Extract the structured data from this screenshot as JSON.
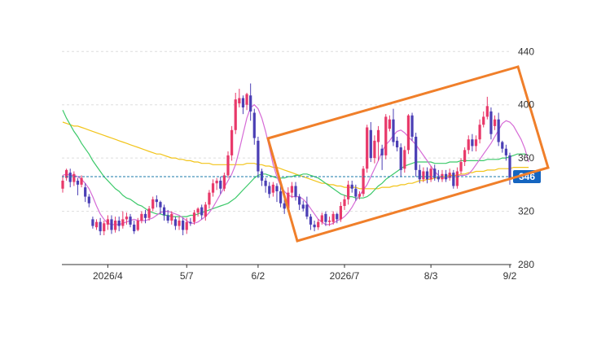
{
  "chart_data": {
    "type": "candlestick",
    "x_tick_labels": [
      "2026/4",
      "5/7",
      "6/2",
      "2026/7",
      "8/3",
      "9/2"
    ],
    "y_tick_labels": [
      "280",
      "320",
      "360",
      "400",
      "440"
    ],
    "y_ticks": [
      280,
      320,
      360,
      400,
      440
    ],
    "ylim": [
      280,
      442
    ],
    "grid": true,
    "last_price": 346,
    "last_price_label": "346",
    "colors": {
      "up": "#e8396a",
      "down": "#4b3fb5",
      "ma_short": "#d66bd6",
      "ma_mid": "#3cc96a",
      "ma_long": "#f2c41a",
      "channel": "#f07f2a",
      "last_price_line": "#1a7aa8",
      "last_price_badge": "#1565c0",
      "grid": "#dddddd",
      "axis": "#333333"
    },
    "candles": [
      [
        337,
        343,
        334,
        347
      ],
      [
        345,
        351,
        343,
        352
      ],
      [
        349,
        342,
        338,
        352
      ],
      [
        342,
        348,
        339,
        350
      ],
      [
        343,
        340,
        332,
        345
      ],
      [
        340,
        345,
        338,
        347
      ],
      [
        338,
        331,
        327,
        341
      ],
      [
        331,
        326,
        323,
        333
      ],
      [
        314,
        309,
        307,
        316
      ],
      [
        308,
        312,
        306,
        314
      ],
      [
        312,
        305,
        302,
        315
      ],
      [
        305,
        311,
        302,
        313
      ],
      [
        310,
        314,
        306,
        317
      ],
      [
        314,
        306,
        303,
        317
      ],
      [
        306,
        313,
        304,
        316
      ],
      [
        313,
        309,
        305,
        316
      ],
      [
        309,
        314,
        307,
        320
      ],
      [
        314,
        316,
        310,
        319
      ],
      [
        316,
        310,
        308,
        318
      ],
      [
        310,
        305,
        303,
        313
      ],
      [
        306,
        313,
        305,
        315
      ],
      [
        313,
        318,
        311,
        320
      ],
      [
        318,
        315,
        311,
        321
      ],
      [
        315,
        322,
        313,
        324
      ],
      [
        322,
        329,
        320,
        331
      ],
      [
        329,
        327,
        323,
        332
      ],
      [
        327,
        323,
        318,
        328
      ],
      [
        323,
        317,
        313,
        325
      ],
      [
        317,
        313,
        311,
        321
      ],
      [
        313,
        318,
        310,
        320
      ],
      [
        314,
        309,
        306,
        316
      ],
      [
        309,
        313,
        306,
        316
      ],
      [
        313,
        306,
        302,
        315
      ],
      [
        306,
        312,
        303,
        315
      ],
      [
        312,
        311,
        309,
        315
      ],
      [
        312,
        319,
        310,
        321
      ],
      [
        319,
        322,
        316,
        323
      ],
      [
        323,
        317,
        314,
        325
      ],
      [
        316,
        325,
        313,
        327
      ],
      [
        325,
        334,
        322,
        336
      ],
      [
        334,
        341,
        331,
        344
      ],
      [
        341,
        343,
        336,
        345
      ],
      [
        343,
        337,
        333,
        346
      ],
      [
        337,
        347,
        335,
        349
      ],
      [
        347,
        362,
        345,
        365
      ],
      [
        362,
        381,
        358,
        384
      ],
      [
        381,
        404,
        378,
        409
      ],
      [
        401,
        405,
        398,
        412
      ],
      [
        405,
        398,
        393,
        407
      ],
      [
        400,
        408,
        396,
        409
      ],
      [
        407,
        395,
        388,
        416
      ],
      [
        394,
        375,
        370,
        397
      ],
      [
        373,
        350,
        345,
        376
      ],
      [
        350,
        343,
        339,
        352
      ],
      [
        343,
        339,
        334,
        345
      ],
      [
        339,
        333,
        330,
        342
      ],
      [
        334,
        340,
        331,
        342
      ],
      [
        339,
        335,
        327,
        341
      ],
      [
        335,
        326,
        323,
        340
      ],
      [
        326,
        322,
        318,
        329
      ],
      [
        322,
        334,
        320,
        338
      ],
      [
        334,
        339,
        330,
        342
      ],
      [
        339,
        331,
        328,
        342
      ],
      [
        331,
        325,
        321,
        333
      ],
      [
        325,
        322,
        320,
        328
      ],
      [
        325,
        316,
        314,
        331
      ],
      [
        316,
        310,
        306,
        318
      ],
      [
        310,
        308,
        305,
        313
      ],
      [
        308,
        312,
        306,
        314
      ],
      [
        312,
        317,
        310,
        319
      ],
      [
        318,
        312,
        309,
        320
      ],
      [
        312,
        313,
        309,
        316
      ],
      [
        312,
        318,
        310,
        320
      ],
      [
        318,
        314,
        311,
        319
      ],
      [
        314,
        324,
        312,
        327
      ],
      [
        324,
        329,
        321,
        332
      ],
      [
        329,
        340,
        325,
        343
      ],
      [
        340,
        337,
        334,
        343
      ],
      [
        337,
        331,
        328,
        340
      ],
      [
        331,
        333,
        329,
        335
      ],
      [
        333,
        352,
        331,
        354
      ],
      [
        352,
        383,
        349,
        385
      ],
      [
        381,
        360,
        357,
        387
      ],
      [
        360,
        373,
        356,
        377
      ],
      [
        372,
        381,
        358,
        384
      ],
      [
        367,
        362,
        351,
        370
      ],
      [
        362,
        391,
        359,
        393
      ],
      [
        382,
        389,
        380,
        392
      ],
      [
        389,
        372,
        369,
        397
      ],
      [
        373,
        368,
        365,
        376
      ],
      [
        368,
        351,
        346,
        371
      ],
      [
        352,
        366,
        349,
        369
      ],
      [
        366,
        392,
        363,
        393
      ],
      [
        392,
        376,
        373,
        394
      ],
      [
        376,
        351,
        346,
        379
      ],
      [
        351,
        344,
        341,
        355
      ],
      [
        344,
        350,
        342,
        353
      ],
      [
        350,
        344,
        341,
        353
      ],
      [
        344,
        352,
        342,
        354
      ],
      [
        352,
        345,
        343,
        355
      ],
      [
        346,
        344,
        342,
        351
      ],
      [
        344,
        348,
        342,
        351
      ],
      [
        348,
        344,
        342,
        351
      ],
      [
        345,
        349,
        343,
        352
      ],
      [
        349,
        339,
        337,
        351
      ],
      [
        339,
        350,
        337,
        353
      ],
      [
        350,
        357,
        348,
        360
      ],
      [
        357,
        366,
        354,
        368
      ],
      [
        366,
        374,
        363,
        377
      ],
      [
        374,
        369,
        365,
        378
      ],
      [
        369,
        374,
        365,
        377
      ],
      [
        374,
        385,
        371,
        389
      ],
      [
        385,
        391,
        383,
        395
      ],
      [
        391,
        399,
        389,
        406
      ],
      [
        395,
        378,
        374,
        398
      ],
      [
        384,
        389,
        381,
        392
      ],
      [
        389,
        372,
        369,
        394
      ],
      [
        372,
        367,
        364,
        373
      ],
      [
        367,
        362,
        358,
        370
      ],
      [
        362,
        345,
        340,
        364
      ]
    ],
    "ma_short": [
      347,
      348,
      347,
      347,
      346,
      344,
      341,
      337,
      331,
      324,
      318,
      314,
      311,
      310,
      310,
      310,
      311,
      312,
      313,
      314,
      313,
      313,
      313,
      314,
      315,
      317,
      319,
      320,
      320,
      319,
      318,
      317,
      315,
      313,
      311,
      311,
      312,
      314,
      316,
      319,
      323,
      328,
      333,
      338,
      343,
      348,
      355,
      366,
      378,
      390,
      398,
      400,
      397,
      390,
      380,
      368,
      355,
      346,
      339,
      335,
      332,
      331,
      331,
      331,
      329,
      326,
      322,
      318,
      314,
      312,
      310,
      310,
      311,
      313,
      314,
      316,
      319,
      323,
      328,
      332,
      336,
      340,
      346,
      352,
      358,
      365,
      370,
      373,
      377,
      380,
      381,
      379,
      376,
      373,
      370,
      366,
      362,
      358,
      354,
      350,
      347,
      345,
      345,
      346,
      346,
      346,
      347,
      347,
      348,
      351,
      355,
      359,
      363,
      367,
      371,
      376,
      381,
      386,
      388,
      387,
      384,
      379,
      374,
      367,
      357
    ],
    "ma_mid": [
      396,
      390,
      385,
      380,
      376,
      371,
      367,
      363,
      358,
      354,
      350,
      346,
      343,
      340,
      337,
      335,
      332,
      330,
      329,
      327,
      325,
      324,
      322,
      320,
      319,
      318,
      318,
      317,
      317,
      316,
      316,
      316,
      316,
      316,
      317,
      317,
      318,
      319,
      320,
      321,
      322,
      323,
      324,
      325,
      326,
      328,
      330,
      333,
      336,
      339,
      342,
      345,
      347,
      348,
      348,
      347,
      346,
      345,
      345,
      345,
      346,
      346,
      347,
      347,
      348,
      348,
      347,
      346,
      345,
      343,
      341,
      339,
      337,
      335,
      333,
      332,
      331,
      331,
      330,
      330,
      330,
      331,
      333,
      336,
      339,
      341,
      344,
      346,
      348,
      350,
      352,
      354,
      355,
      356,
      357,
      357,
      357,
      357,
      357,
      356,
      356,
      356,
      356,
      357,
      357,
      357,
      358,
      358,
      358,
      358,
      358,
      358,
      358,
      359,
      359,
      359,
      359,
      360,
      360,
      361,
      362,
      363,
      363,
      363,
      362
    ],
    "ma_long": [
      387,
      386,
      385,
      384,
      384,
      383,
      382,
      381,
      380,
      379,
      378,
      377,
      376,
      375,
      374,
      373,
      372,
      371,
      370,
      369,
      368,
      367,
      366,
      365,
      364,
      363,
      363,
      362,
      361,
      360,
      360,
      359,
      359,
      358,
      358,
      357,
      357,
      356,
      356,
      356,
      355,
      355,
      355,
      355,
      355,
      355,
      355,
      355,
      355,
      356,
      356,
      356,
      355,
      355,
      354,
      354,
      353,
      353,
      352,
      351,
      350,
      349,
      348,
      347,
      346,
      345,
      344,
      343,
      342,
      341,
      341,
      340,
      340,
      339,
      339,
      338,
      338,
      338,
      338,
      337,
      337,
      337,
      337,
      337,
      337,
      338,
      338,
      338,
      339,
      339,
      340,
      340,
      341,
      341,
      342,
      343,
      343,
      344,
      344,
      345,
      345,
      346,
      346,
      347,
      347,
      347,
      348,
      348,
      349,
      349,
      350,
      350,
      350,
      351,
      351,
      351,
      352,
      352,
      352,
      352,
      353,
      353,
      353,
      353,
      353
    ]
  }
}
